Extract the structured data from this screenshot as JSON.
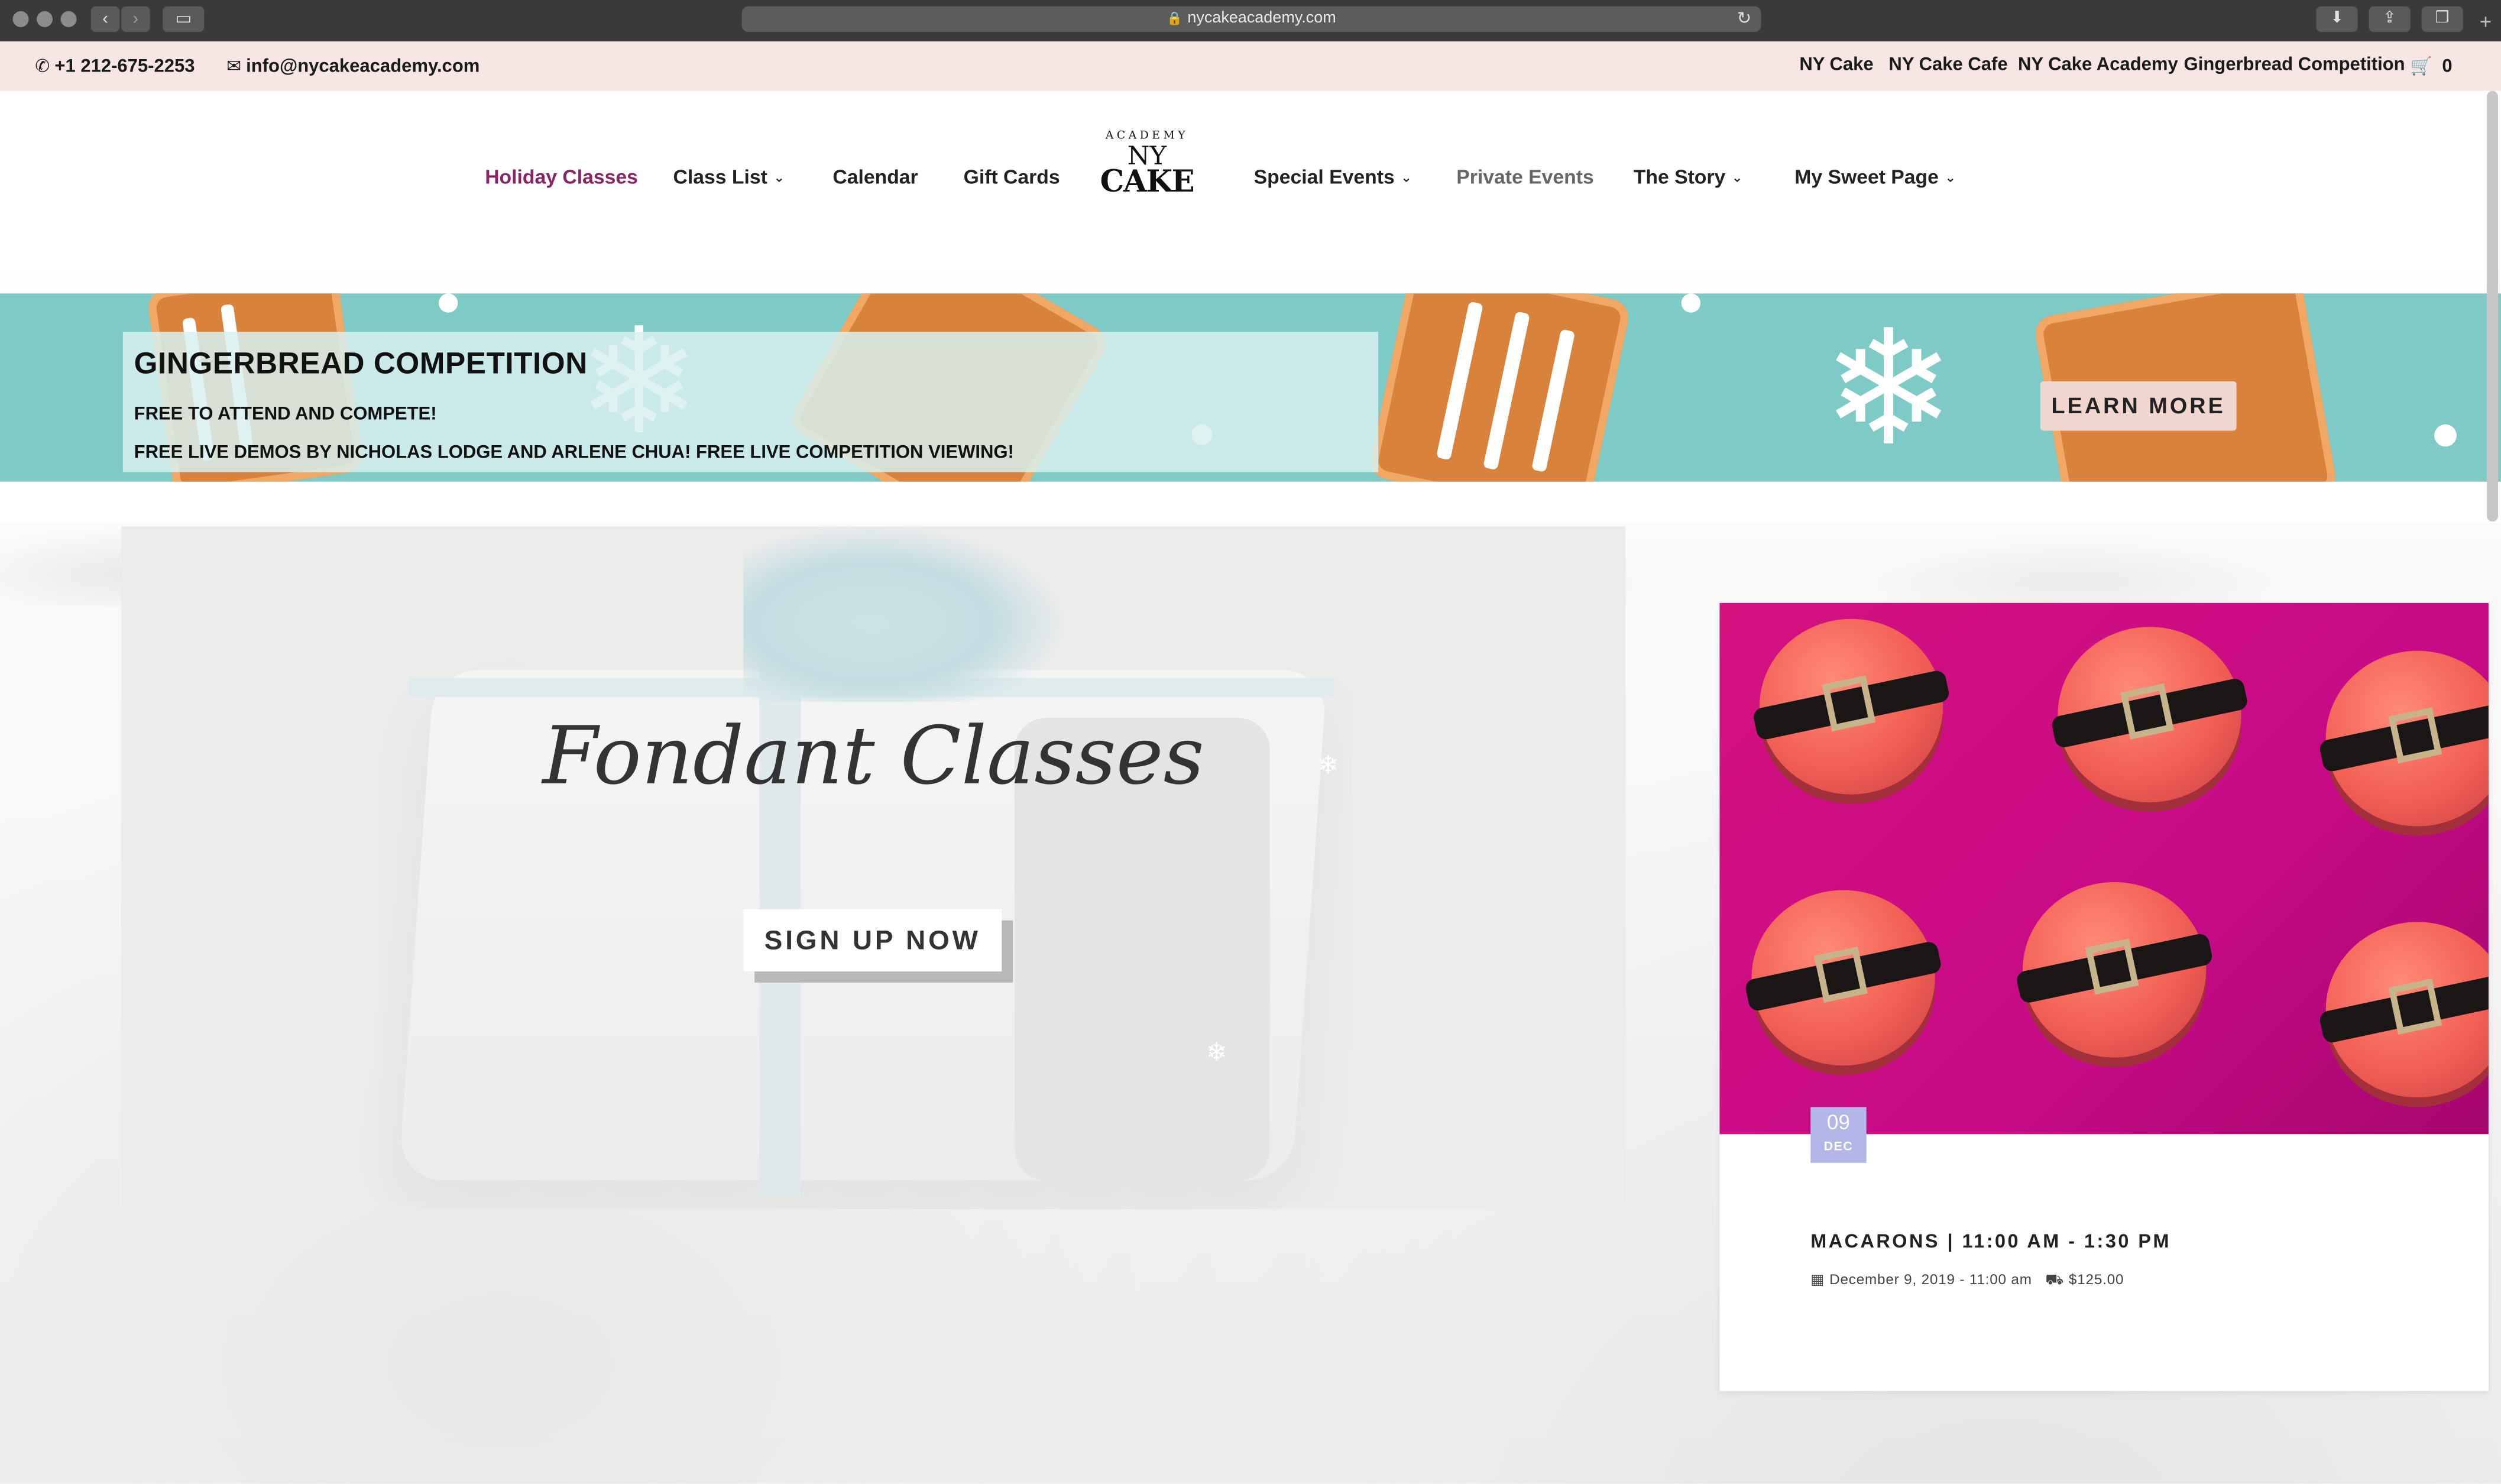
{
  "browser": {
    "url": "nycakeacademy.com"
  },
  "topbar": {
    "phone": "+1 212-675-2253",
    "email": "info@nycakeacademy.com",
    "links": [
      "NY Cake",
      "NY Cake Cafe",
      "NY Cake Academy",
      "Gingerbread Competition"
    ],
    "cart_count": "0"
  },
  "nav": {
    "items": [
      {
        "label": "Holiday Classes"
      },
      {
        "label": "Class List"
      },
      {
        "label": "Calendar"
      },
      {
        "label": "Gift Cards"
      },
      {
        "label": "Special Events"
      },
      {
        "label": "Private Events"
      },
      {
        "label": "The Story"
      },
      {
        "label": "My Sweet Page"
      }
    ],
    "logo": {
      "arc": "ACADEMY",
      "ny": "NY",
      "cake": "CAKE"
    }
  },
  "banner": {
    "title": "GINGERBREAD COMPETITION",
    "line1": "FREE TO ATTEND AND COMPETE!",
    "line2": "FREE LIVE DEMOS BY NICHOLAS LODGE AND ARLENE CHUA! FREE LIVE COMPETITION VIEWING!",
    "button": "LEARN MORE"
  },
  "hero": {
    "title": "Fondant Classes",
    "button": "SIGN UP NOW"
  },
  "event": {
    "day": "09",
    "month": "DEC",
    "title": "MACARONS | 11:00 AM - 1:30 PM",
    "datetime": "December 9, 2019 - 11:00 am",
    "price": "$125.00"
  },
  "colors": {
    "accent": "#8b2367",
    "banner_bg": "#7ecac7",
    "topbar_bg": "#f7e6e4",
    "date_badge": "#b3b6e6"
  }
}
